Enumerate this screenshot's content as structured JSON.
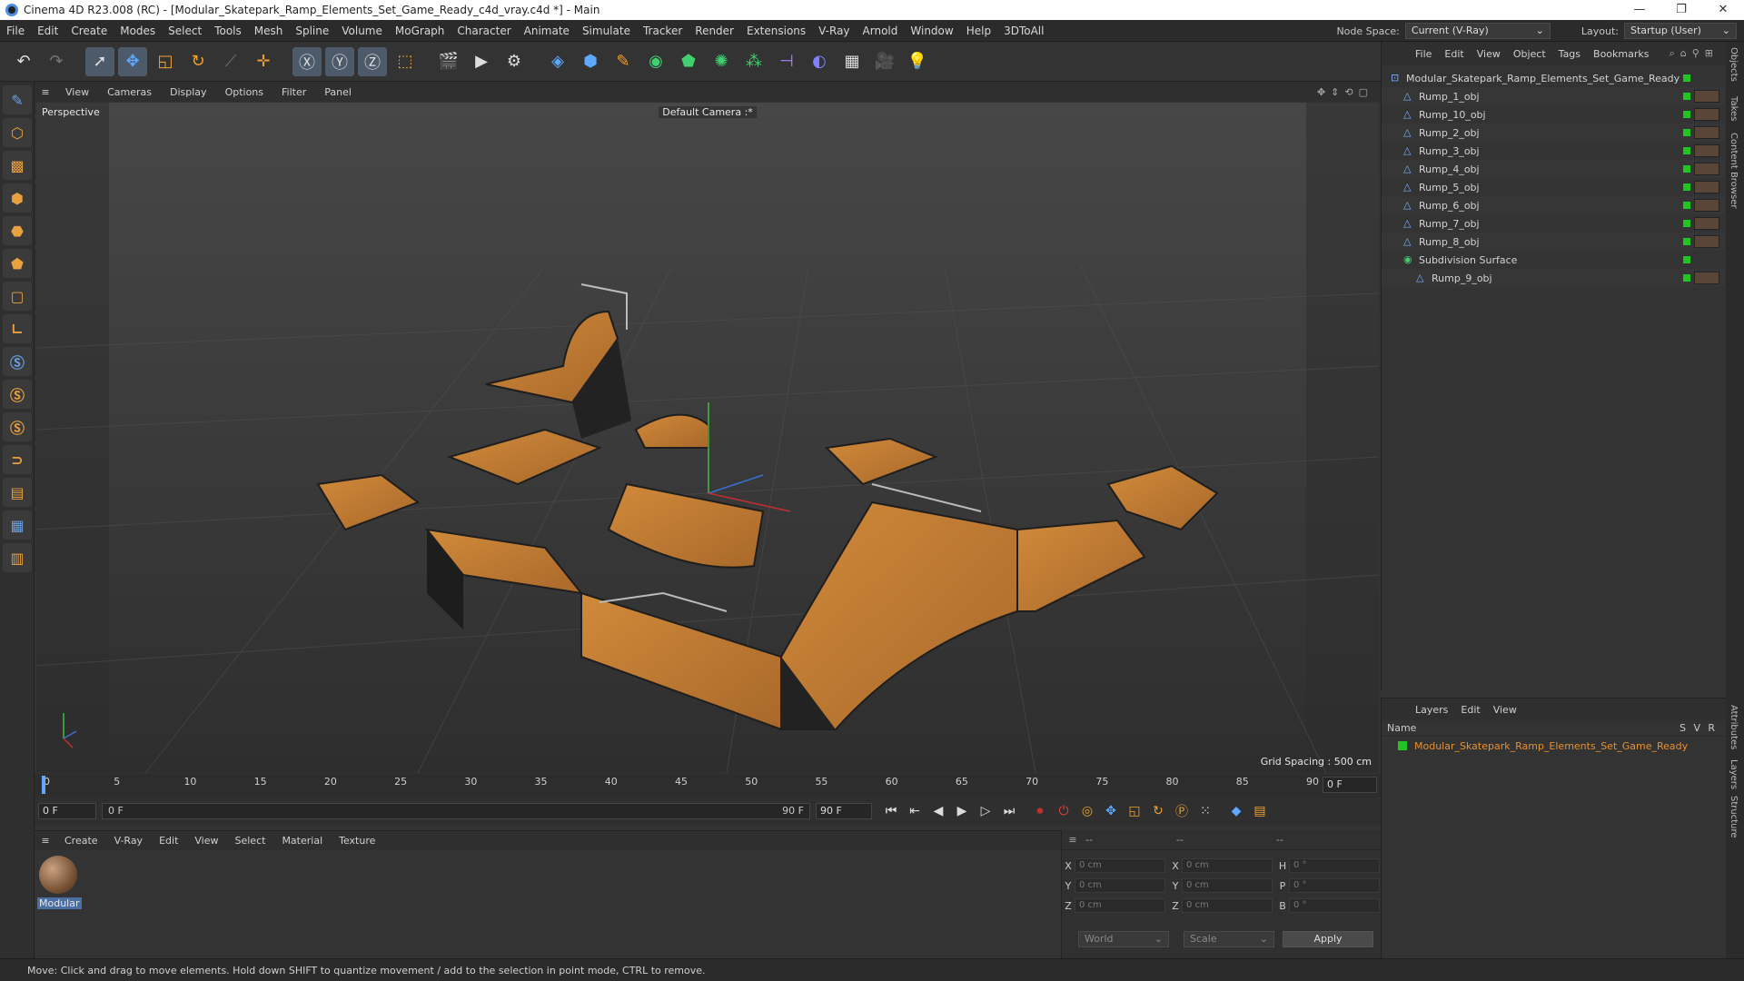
{
  "window": {
    "title": "Cinema 4D R23.008 (RC) - [Modular_Skatepark_Ramp_Elements_Set_Game_Ready_c4d_vray.c4d *] - Main",
    "controls": [
      "—",
      "❐",
      "✕"
    ]
  },
  "menu": {
    "items": [
      "File",
      "Edit",
      "Create",
      "Modes",
      "Select",
      "Tools",
      "Mesh",
      "Spline",
      "Volume",
      "MoGraph",
      "Character",
      "Animate",
      "Simulate",
      "Tracker",
      "Render",
      "Extensions",
      "V-Ray",
      "Arnold",
      "Window",
      "Help",
      "3DToAll"
    ],
    "node_space_label": "Node Space:",
    "node_space_value": "Current (V-Ray)",
    "layout_label": "Layout:",
    "layout_value": "Startup (User)"
  },
  "viewport": {
    "menu": [
      "View",
      "Cameras",
      "Display",
      "Options",
      "Filter",
      "Panel"
    ],
    "label": "Perspective",
    "camera": "Default Camera :*",
    "grid_spacing": "Grid Spacing : 500 cm"
  },
  "timeline": {
    "ticks": [
      "0",
      "5",
      "10",
      "15",
      "20",
      "25",
      "30",
      "35",
      "40",
      "45",
      "50",
      "55",
      "60",
      "65",
      "70",
      "75",
      "80",
      "85",
      "90"
    ],
    "current_frame_right": "0 F",
    "start": "0 F",
    "range_start": "0 F",
    "range_end": "90 F",
    "end": "90 F"
  },
  "material_manager": {
    "menu": [
      "Create",
      "V-Ray",
      "Edit",
      "View",
      "Select",
      "Material",
      "Texture"
    ],
    "materials": [
      {
        "name": "Modular"
      }
    ]
  },
  "coordinates": {
    "header": [
      "--",
      "--",
      "--"
    ],
    "rows": [
      {
        "l1": "X",
        "v1": "0 cm",
        "l2": "X",
        "v2": "0 cm",
        "l3": "H",
        "v3": "0 °"
      },
      {
        "l1": "Y",
        "v1": "0 cm",
        "l2": "Y",
        "v2": "0 cm",
        "l3": "P",
        "v3": "0 °"
      },
      {
        "l1": "Z",
        "v1": "0 cm",
        "l2": "Z",
        "v2": "0 cm",
        "l3": "B",
        "v3": "0 °"
      }
    ],
    "mode1": "World",
    "mode2": "Scale",
    "apply": "Apply"
  },
  "objects": {
    "menu": [
      "File",
      "Edit",
      "View",
      "Object",
      "Tags",
      "Bookmarks"
    ],
    "items": [
      {
        "name": "Modular_Skatepark_Ramp_Elements_Set_Game_Ready",
        "indent": 0
      },
      {
        "name": "Rump_1_obj",
        "indent": 1
      },
      {
        "name": "Rump_10_obj",
        "indent": 1
      },
      {
        "name": "Rump_2_obj",
        "indent": 1
      },
      {
        "name": "Rump_3_obj",
        "indent": 1
      },
      {
        "name": "Rump_4_obj",
        "indent": 1
      },
      {
        "name": "Rump_5_obj",
        "indent": 1
      },
      {
        "name": "Rump_6_obj",
        "indent": 1
      },
      {
        "name": "Rump_7_obj",
        "indent": 1
      },
      {
        "name": "Rump_8_obj",
        "indent": 1
      },
      {
        "name": "Subdivision Surface",
        "indent": 1
      },
      {
        "name": "Rump_9_obj",
        "indent": 2
      }
    ]
  },
  "layers": {
    "menu": [
      "Layers",
      "Edit",
      "View"
    ],
    "header_name": "Name",
    "header_cols": [
      "S",
      "V",
      "R"
    ],
    "items": [
      {
        "name": "Modular_Skatepark_Ramp_Elements_Set_Game_Ready",
        "color": "#22c322"
      }
    ]
  },
  "side_tabs": [
    "Objects",
    "Takes",
    "Content Browser",
    "Attributes",
    "Layers",
    "Structure"
  ],
  "status": "Move: Click and drag to move elements. Hold down SHIFT to quantize movement / add to the selection in point mode, CTRL to remove.",
  "colors": {
    "accent_orange": "#e89030",
    "layer_green": "#22c322",
    "selection_blue": "#4a6fa5"
  }
}
